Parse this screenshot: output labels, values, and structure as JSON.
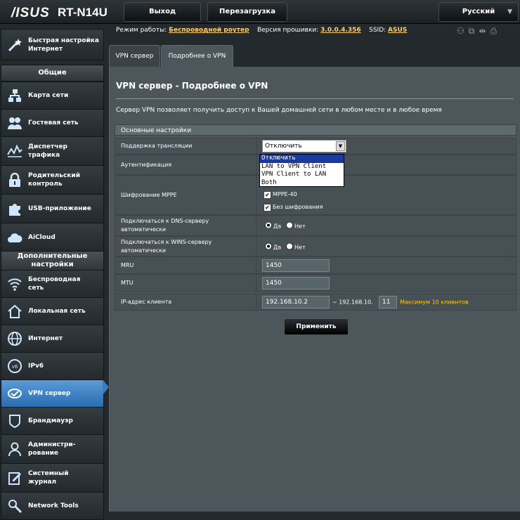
{
  "header": {
    "logo": "/ISUS",
    "model": "RT-N14U",
    "logout_label": "Выход",
    "reboot_label": "Перезагрузка",
    "language": "Русский"
  },
  "sidebar": {
    "quick_setup": "Быстрая настройка\nИнтернет",
    "general_title": "Общие",
    "general_items": [
      {
        "label": "Карта сети",
        "icon": "network-map-icon"
      },
      {
        "label": "Гостевая сеть",
        "icon": "guest-network-icon"
      },
      {
        "label": "Диспетчер\nтрафика",
        "icon": "traffic-manager-icon"
      },
      {
        "label": "Родительский\nконтроль",
        "icon": "parental-control-icon"
      },
      {
        "label": "USB-приложение",
        "icon": "usb-app-icon"
      },
      {
        "label": "AiCloud",
        "icon": "aicloud-icon"
      }
    ],
    "advanced_title": "Дополнительные\nнастройки",
    "advanced_items": [
      {
        "label": "Беспроводная\nсеть",
        "icon": "wireless-icon"
      },
      {
        "label": "Локальная сеть",
        "icon": "lan-icon"
      },
      {
        "label": "Интернет",
        "icon": "internet-icon"
      },
      {
        "label": "IPv6",
        "icon": "ipv6-icon"
      },
      {
        "label": "VPN сервер",
        "icon": "vpn-icon"
      },
      {
        "label": "Брандмауэр",
        "icon": "firewall-icon"
      },
      {
        "label": "Администри-\nрование",
        "icon": "admin-icon"
      },
      {
        "label": "Системный\nжурнал",
        "icon": "syslog-icon"
      },
      {
        "label": "Network Tools",
        "icon": "network-tools-icon"
      }
    ]
  },
  "status": {
    "mode_label": "Режим работы:",
    "mode_value": "Беспроводной роутер",
    "firmware_label": "Версия прошивки:",
    "firmware_value": "3.0.0.4.356",
    "ssid_label": "SSID:",
    "ssid_value": "ASUS"
  },
  "tabs": [
    "VPN сервер",
    "Подробнее о VPN"
  ],
  "main": {
    "title": "VPN сервер - Подробнее о VPN",
    "description": "Сервер VPN позволяет получить доступ к Вашей домашней сети в любом месте и в любое время",
    "section_title": "Основные настройки",
    "broadcast_label": "Поддержка трансляции",
    "broadcast_value": "Отключить",
    "broadcast_options": [
      "Отключить",
      "LAN to VPN Client",
      "VPN Client to LAN",
      "Both"
    ],
    "auth_label": "Аутентификация",
    "mppe_label": "Шифрование MPPE",
    "mppe_options": [
      "MPPE-40",
      "Без шифрования"
    ],
    "dns_label": "Подключаться к DNS-серверу\nавтоматически",
    "wins_label": "Подключаться к WINS-серверу\nавтоматически",
    "yes": "Да",
    "no": "Нет",
    "mru_label": "MRU",
    "mru_value": "1450",
    "mtu_label": "MTU",
    "mtu_value": "1450",
    "ip_label": "IP-адрес клиента",
    "ip_start": "192.168.10.2",
    "ip_end_prefix": "~ 192.168.10.",
    "ip_end": "11",
    "ip_note": "Максимум 10 клиентов",
    "apply_label": "Применить"
  },
  "colors": {
    "active_nav": "#3b7cc0",
    "note": "#ffcc00",
    "link": "#ffcc66"
  }
}
